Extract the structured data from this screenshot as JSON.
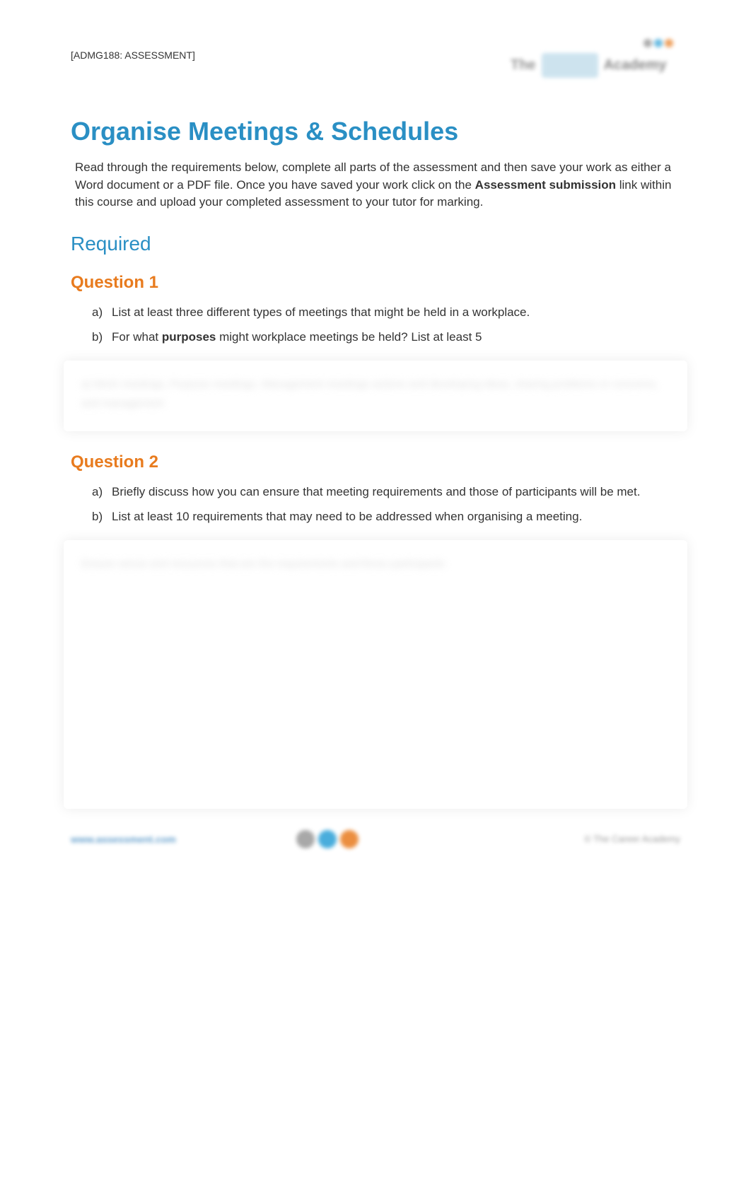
{
  "header": {
    "code": "[ADMG188: ASSESSMENT]"
  },
  "title": "Organise Meetings & Schedules",
  "intro": {
    "part1": "Read through the requirements below, complete all parts of the assessment and then save your work as either a Word document or a PDF file. Once you have saved your work click on the ",
    "bold": "Assessment submission",
    "part2": " link within this course and upload your completed assessment to your tutor for marking."
  },
  "required": "Required",
  "q1": {
    "title": "Question 1",
    "a_marker": "a)",
    "a_text": "List at least three different types of meetings that might be held in a workplace.",
    "b_marker": "b)",
    "b_text1": "For what ",
    "b_bold": "purposes",
    "b_text2": " might workplace meetings be held?  List at least 5",
    "answer_blur": "a) Work meetings, Purpose meetings, Management meetings\n\n\nactions and developing ideas, sharing problems or concerns, and management"
  },
  "q2": {
    "title": "Question 2",
    "a_marker": "a)",
    "a_text": "Briefly discuss how you can ensure that meeting requirements and those of participants will be met.",
    "b_marker": "b)",
    "b_text": "List at least 10 requirements that may need to be addressed when organising a meeting.",
    "answer_blur": "Ensure venue and resources that are the requirements and those participants"
  },
  "footer": {
    "left": "www.assessment.com",
    "right": "© The Career Academy"
  }
}
